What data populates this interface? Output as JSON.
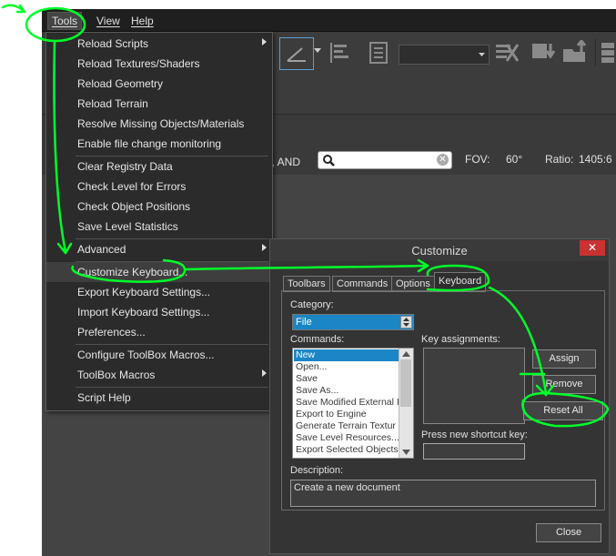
{
  "menubar": {
    "items": [
      {
        "label": "Tools"
      },
      {
        "label": "View"
      },
      {
        "label": "Help"
      }
    ]
  },
  "statusbar": {
    "filter_text": "d, AND",
    "search": {
      "value": "",
      "placeholder": ""
    },
    "fov_label": "FOV:",
    "fov_value": "60°",
    "ratio_label": "Ratio:",
    "ratio_value": "1405:6"
  },
  "tools_menu": {
    "items": [
      {
        "label": "Reload Scripts",
        "submenu": true
      },
      {
        "label": "Reload Textures/Shaders"
      },
      {
        "label": "Reload Geometry"
      },
      {
        "label": "Reload Terrain"
      },
      {
        "label": "Resolve Missing Objects/Materials"
      },
      {
        "label": "Enable file change monitoring"
      },
      {
        "label": "Clear Registry Data"
      },
      {
        "label": "Check Level for Errors"
      },
      {
        "label": "Check Object Positions"
      },
      {
        "label": "Save Level Statistics"
      },
      {
        "label": "Advanced",
        "submenu": true
      },
      {
        "label": "Customize Keyboard..."
      },
      {
        "label": "Export Keyboard Settings..."
      },
      {
        "label": "Import Keyboard Settings..."
      },
      {
        "label": "Preferences..."
      },
      {
        "label": "Configure ToolBox Macros..."
      },
      {
        "label": "ToolBox Macros",
        "submenu": true
      },
      {
        "label": "Script Help"
      }
    ]
  },
  "dialog": {
    "title": "Customize",
    "close_icon": "close-icon",
    "tabs": [
      {
        "label": "Toolbars"
      },
      {
        "label": "Commands"
      },
      {
        "label": "Options"
      },
      {
        "label": "Keyboard"
      }
    ],
    "active_tab": "Keyboard",
    "category_label": "Category:",
    "category_value": "File",
    "commands_label": "Commands:",
    "commands": [
      "New",
      "Open...",
      "Save",
      "Save As...",
      "Save Modified External I",
      "Export to Engine",
      "Generate Terrain Textur",
      "Save Level Resources...",
      "Export Selected Objects"
    ],
    "selected_command": "New",
    "key_assignments_label": "Key assignments:",
    "assign_label": "Assign",
    "remove_label": "Remove",
    "reset_all_label": "Reset All",
    "shortcut_label": "Press new shortcut key:",
    "description_label": "Description:",
    "description_value": "Create a new document",
    "close_label": "Close"
  },
  "annotation_color": "#00ff2a"
}
